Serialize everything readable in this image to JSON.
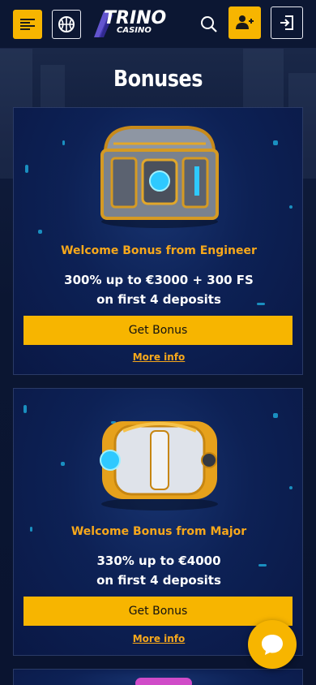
{
  "header": {
    "logo_main": "TRINO",
    "logo_sub": "CASINO",
    "menu_icon": "menu-icon",
    "sport_icon": "basketball-icon",
    "search_icon": "search-icon",
    "register_icon": "add-user-icon",
    "login_icon": "login-icon",
    "accent_color": "#f7b500"
  },
  "page": {
    "title": "Bonuses"
  },
  "bonuses": [
    {
      "title": "Welcome Bonus from Engineer",
      "offer_line1": "300% up to €3000 + 300 FS",
      "offer_line2": "on first 4 deposits",
      "button_label": "Get Bonus",
      "more_label": "More info"
    },
    {
      "title": "Welcome Bonus from Major",
      "offer_line1": "330% up to €4000",
      "offer_line2": "on first 4 deposits",
      "button_label": "Get Bonus",
      "more_label": "More info"
    }
  ],
  "chat": {
    "icon": "chat-bubble-icon"
  }
}
